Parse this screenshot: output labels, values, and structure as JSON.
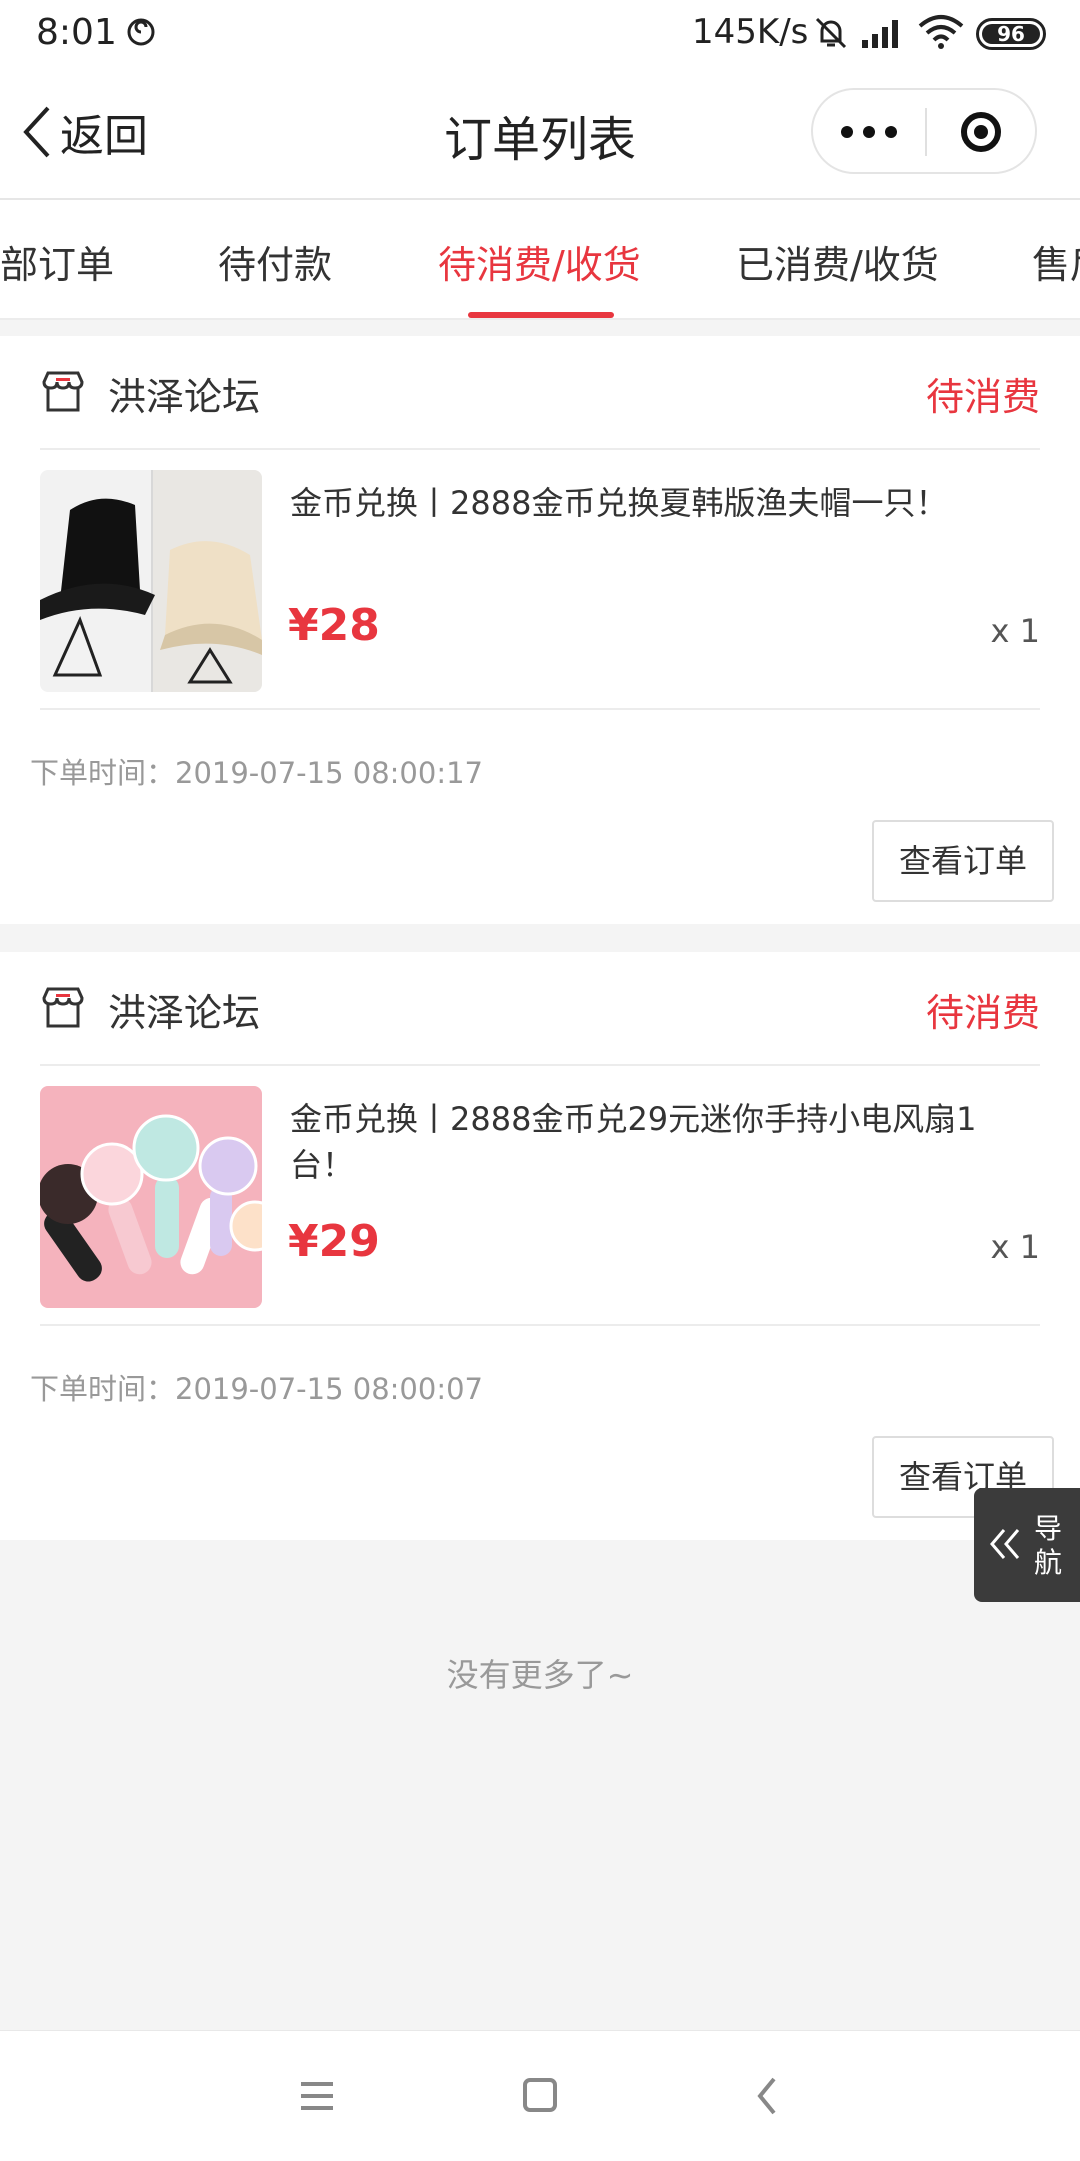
{
  "status_bar": {
    "time": "8:01",
    "net_speed": "145K/s",
    "battery": "96"
  },
  "nav": {
    "back_label": "返回",
    "title": "订单列表"
  },
  "tabs": [
    {
      "label": "部订单"
    },
    {
      "label": "待付款"
    },
    {
      "label": "待消费/收货"
    },
    {
      "label": "已消费/收货"
    },
    {
      "label": "售后"
    }
  ],
  "active_tab": "待消费/收货",
  "orders": [
    {
      "store": "洪泽论坛",
      "status": "待消费",
      "title": "金币兑换丨2888金币兑换夏韩版渔夫帽一只！",
      "price": "¥28",
      "qty": "x 1",
      "order_time": "下单时间：2019-07-15 08:00:17",
      "button": "查看订单"
    },
    {
      "store": "洪泽论坛",
      "status": "待消费",
      "title": "金币兑换丨2888金币兑29元迷你手持小电风扇1台！",
      "price": "¥29",
      "qty": "x 1",
      "order_time": "下单时间：2019-07-15 08:00:07",
      "button": "查看订单"
    }
  ],
  "no_more": "没有更多了~",
  "float_nav": {
    "line1": "导",
    "line2": "航"
  },
  "colors": {
    "accent": "#e8363f",
    "muted": "#999999",
    "bg": "#f4f4f4"
  }
}
